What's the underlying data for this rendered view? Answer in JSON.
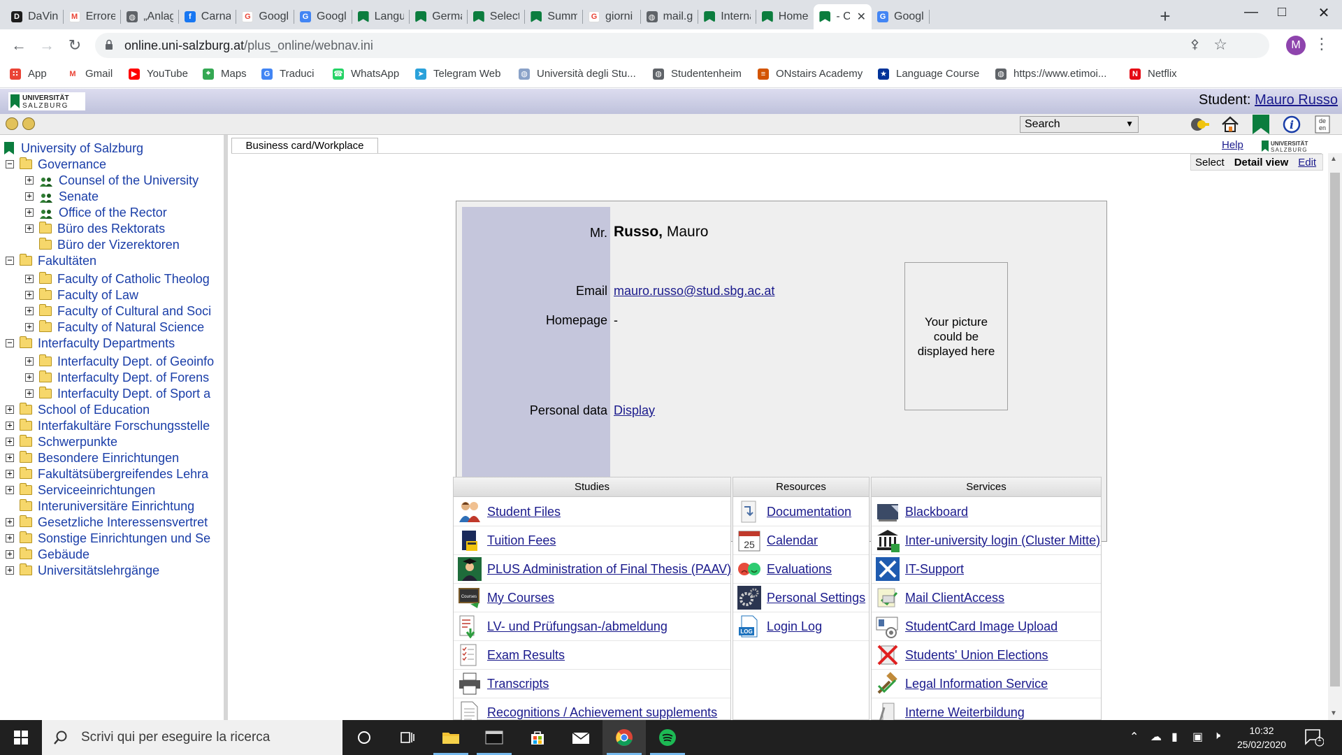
{
  "browser": {
    "tabs": [
      {
        "title": "DaVinci",
        "color": "#1d1d1d",
        "glyph": "D"
      },
      {
        "title": "Errore t",
        "color": "#ffffff",
        "glyph": "M"
      },
      {
        "title": "„Anlage",
        "color": "#5f6368",
        "glyph": "◍"
      },
      {
        "title": "Carnava",
        "color": "#1877f2",
        "glyph": "f"
      },
      {
        "title": "Google",
        "color": "#ffffff",
        "glyph": "G"
      },
      {
        "title": "Google",
        "color": "#4285f4",
        "glyph": "G"
      },
      {
        "title": "Langua",
        "color": "#0b7d3e",
        "glyph": ""
      },
      {
        "title": "German",
        "color": "#0b7d3e",
        "glyph": ""
      },
      {
        "title": "Selectin",
        "color": "#0b7d3e",
        "glyph": ""
      },
      {
        "title": "Summe",
        "color": "#0b7d3e",
        "glyph": ""
      },
      {
        "title": "giorni d",
        "color": "#ffffff",
        "glyph": "G"
      },
      {
        "title": "mail.go",
        "color": "#5f6368",
        "glyph": "◍"
      },
      {
        "title": "Internat",
        "color": "#0b7d3e",
        "glyph": ""
      },
      {
        "title": "Home -",
        "color": "#0b7d3e",
        "glyph": ""
      },
      {
        "title": "- CA",
        "color": "#0b7d3e",
        "glyph": ""
      },
      {
        "title": "Google",
        "color": "#4285f4",
        "glyph": "G"
      }
    ],
    "url_host": "online.uni-salzburg.at",
    "url_path": "/plus_online/webnav.ini",
    "profile_initial": "M",
    "bookmarks": [
      {
        "label": "App",
        "color": "#ea4335",
        "glyph": "∷"
      },
      {
        "label": "Gmail",
        "color": "#ffffff",
        "glyph": "M"
      },
      {
        "label": "YouTube",
        "color": "#ff0000",
        "glyph": "▶"
      },
      {
        "label": "Maps",
        "color": "#34a853",
        "glyph": "⌖"
      },
      {
        "label": "Traduci",
        "color": "#4285f4",
        "glyph": "G"
      },
      {
        "label": "WhatsApp",
        "color": "#25d366",
        "glyph": "☎"
      },
      {
        "label": "Telegram Web",
        "color": "#2aa1da",
        "glyph": "➤"
      },
      {
        "label": "Università degli Stu...",
        "color": "#8aa2c8",
        "glyph": "◍"
      },
      {
        "label": "Studentenheim",
        "color": "#5f6368",
        "glyph": "◍"
      },
      {
        "label": "ONstairs Academy",
        "color": "#d35400",
        "glyph": "≡"
      },
      {
        "label": "Language Course",
        "color": "#003399",
        "glyph": "★"
      },
      {
        "label": "https://www.etimoi...",
        "color": "#5f6368",
        "glyph": "◍"
      },
      {
        "label": "Netflix",
        "color": "#e50914",
        "glyph": "N"
      }
    ]
  },
  "header": {
    "student_prefix": "Student:",
    "student_name": "Mauro Russo",
    "search_label": "Search"
  },
  "tree": {
    "root": "University of Salzburg",
    "items": [
      {
        "label": "Governance",
        "level": 0,
        "pm": "−",
        "icon": "folder"
      },
      {
        "label": "Counsel of the University",
        "level": 1,
        "pm": "+",
        "icon": "people"
      },
      {
        "label": "Senate",
        "level": 1,
        "pm": "+",
        "icon": "people"
      },
      {
        "label": "Office of the Rector",
        "level": 1,
        "pm": "+",
        "icon": "people"
      },
      {
        "label": "Büro des Rektorats",
        "level": 1,
        "pm": "+",
        "icon": "folder"
      },
      {
        "label": "Büro der Vizerektoren",
        "level": 1,
        "pm": "",
        "icon": "folder"
      },
      {
        "label": "Fakultäten",
        "level": 0,
        "pm": "−",
        "icon": "folder"
      },
      {
        "label": "Faculty of Catholic Theolog",
        "level": 1,
        "pm": "+",
        "icon": "folder"
      },
      {
        "label": "Faculty of Law",
        "level": 1,
        "pm": "+",
        "icon": "folder"
      },
      {
        "label": "Faculty of Cultural and Soci",
        "level": 1,
        "pm": "+",
        "icon": "folder"
      },
      {
        "label": "Faculty of Natural Science",
        "level": 1,
        "pm": "+",
        "icon": "folder"
      },
      {
        "label": "Interfaculty Departments",
        "level": 0,
        "pm": "−",
        "icon": "folder"
      },
      {
        "label": "Interfaculty Dept. of Geoinfo",
        "level": 1,
        "pm": "+",
        "icon": "folder"
      },
      {
        "label": "Interfaculty Dept. of Forens",
        "level": 1,
        "pm": "+",
        "icon": "folder"
      },
      {
        "label": "Interfaculty Dept. of Sport a",
        "level": 1,
        "pm": "+",
        "icon": "folder"
      },
      {
        "label": "School of Education",
        "level": 0,
        "pm": "+",
        "icon": "folder"
      },
      {
        "label": "Interfakultäre Forschungsstelle",
        "level": 0,
        "pm": "+",
        "icon": "folder"
      },
      {
        "label": "Schwerpunkte",
        "level": 0,
        "pm": "+",
        "icon": "folder"
      },
      {
        "label": "Besondere Einrichtungen",
        "level": 0,
        "pm": "+",
        "icon": "folder"
      },
      {
        "label": "Fakultätsübergreifendes Lehra",
        "level": 0,
        "pm": "+",
        "icon": "folder"
      },
      {
        "label": "Serviceeinrichtungen",
        "level": 0,
        "pm": "+",
        "icon": "folder"
      },
      {
        "label": "Interuniversitäre Einrichtung",
        "level": 0,
        "pm": "",
        "icon": "folder"
      },
      {
        "label": "Gesetzliche Interessensvertret",
        "level": 0,
        "pm": "+",
        "icon": "folder"
      },
      {
        "label": "Sonstige Einrichtungen und Se",
        "level": 0,
        "pm": "+",
        "icon": "folder"
      },
      {
        "label": "Gebäude",
        "level": 0,
        "pm": "+",
        "icon": "folder"
      },
      {
        "label": "Universitätslehrgänge",
        "level": 0,
        "pm": "+",
        "icon": "folder"
      }
    ]
  },
  "main": {
    "tab_label": "Business card/Workplace",
    "help": "Help",
    "view": {
      "select": "Select",
      "detail": "Detail view",
      "edit": "Edit"
    },
    "card": {
      "salutation": "Mr.",
      "surname": "Russo,",
      "firstname": "Mauro",
      "email_label": "Email",
      "email": "mauro.russo@stud.sbg.ac.at",
      "homepage_label": "Homepage",
      "homepage": "-",
      "personal_label": "Personal data",
      "personal_link": "Display",
      "picture_text": "Your picture could be displayed here"
    },
    "studies": {
      "title": "Studies",
      "items": [
        {
          "label": "Student Files",
          "icon": "students-icon"
        },
        {
          "label": "Tuition Fees",
          "icon": "tuition-icon"
        },
        {
          "label": "PLUS Administration of Final Thesis (PAAV)",
          "icon": "graduate-icon"
        },
        {
          "label": "My Courses",
          "icon": "courses-icon"
        },
        {
          "label": "LV- und Prüfungsan-/abmeldung",
          "icon": "registration-icon"
        },
        {
          "label": "Exam Results",
          "icon": "exam-results-icon"
        },
        {
          "label": "Transcripts",
          "icon": "printer-icon"
        },
        {
          "label": "Recognitions / Achievement supplements",
          "icon": "document-icon"
        }
      ]
    },
    "resources": {
      "title": "Resources",
      "items": [
        {
          "label": "Documentation",
          "icon": "documentation-icon"
        },
        {
          "label": "Calendar",
          "icon": "calendar-icon"
        },
        {
          "label": "Evaluations",
          "icon": "smileys-icon"
        },
        {
          "label": "Personal Settings",
          "icon": "gears-icon"
        },
        {
          "label": "Login Log",
          "icon": "log-icon"
        }
      ],
      "calendar_day": "25",
      "log_text": "LOG"
    },
    "services": {
      "title": "Services",
      "items": [
        {
          "label": "Blackboard",
          "icon": "blackboard-icon"
        },
        {
          "label": "Inter-university login (Cluster Mitte)",
          "icon": "institution-icon"
        },
        {
          "label": "IT-Support",
          "icon": "tools-icon"
        },
        {
          "label": "Mail ClientAccess",
          "icon": "mail-client-icon"
        },
        {
          "label": "StudentCard Image Upload",
          "icon": "card-upload-icon"
        },
        {
          "label": "Students' Union Elections",
          "icon": "election-icon"
        },
        {
          "label": "Legal Information Service",
          "icon": "legal-icon"
        },
        {
          "label": "Interne Weiterbildung",
          "icon": "training-icon"
        }
      ]
    }
  },
  "taskbar": {
    "search_placeholder": "Scrivi qui per eseguire la ricerca",
    "time": "10:32",
    "date": "25/02/2020",
    "notification_count": "1"
  },
  "colors": {
    "link": "#1a1a8c",
    "tree_link": "#1a3ea8",
    "card_side": "#c5c6dc",
    "uni_green": "#0b7d3e"
  }
}
